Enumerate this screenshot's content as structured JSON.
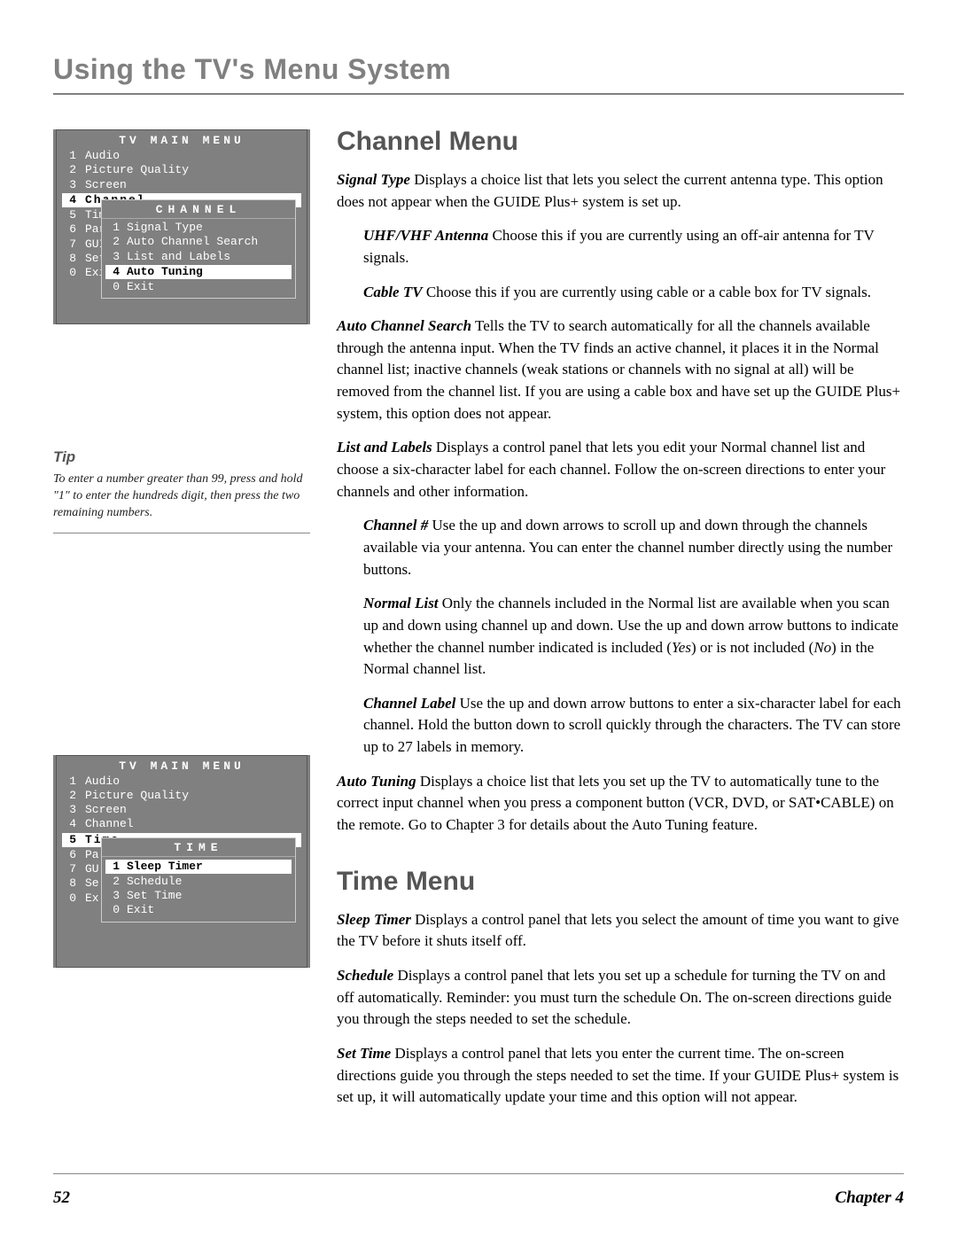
{
  "page_title": "Using the TV's Menu System",
  "footer": {
    "page_num": "52",
    "chapter": "Chapter 4"
  },
  "tip": {
    "heading": "Tip",
    "text": "To enter a number greater than 99, press and hold \"1\" to enter the hundreds digit, then press the two remaining numbers."
  },
  "figure1": {
    "main_title": "TV MAIN MENU",
    "items": [
      {
        "n": "1",
        "label": "Audio"
      },
      {
        "n": "2",
        "label": "Picture Quality"
      },
      {
        "n": "3",
        "label": "Screen"
      },
      {
        "n": "4",
        "label": "Channel",
        "selected": true
      },
      {
        "n": "5",
        "label": "Time"
      },
      {
        "n": "6",
        "label": "Pare"
      },
      {
        "n": "7",
        "label": "GUID"
      },
      {
        "n": "8",
        "label": "Setu"
      },
      {
        "n": "0",
        "label": "Exit"
      }
    ],
    "sub_title": "CHANNEL",
    "sub_items": [
      {
        "n": "1",
        "label": "Signal Type"
      },
      {
        "n": "2",
        "label": "Auto Channel Search"
      },
      {
        "n": "3",
        "label": "List and Labels"
      },
      {
        "n": "4",
        "label": "Auto Tuning",
        "selected": true
      },
      {
        "n": "0",
        "label": "Exit"
      }
    ]
  },
  "figure2": {
    "main_title": "TV MAIN MENU",
    "items": [
      {
        "n": "1",
        "label": "Audio"
      },
      {
        "n": "2",
        "label": "Picture Quality"
      },
      {
        "n": "3",
        "label": "Screen"
      },
      {
        "n": "4",
        "label": "Channel"
      },
      {
        "n": "5",
        "label": "Time",
        "selected": true
      },
      {
        "n": "6",
        "label": "Pa"
      },
      {
        "n": "7",
        "label": "GU"
      },
      {
        "n": "8",
        "label": "Se"
      },
      {
        "n": "0",
        "label": "Ex"
      }
    ],
    "sub_title": "TIME",
    "sub_items": [
      {
        "n": "1",
        "label": "Sleep Timer",
        "selected": true
      },
      {
        "n": "2",
        "label": "Schedule"
      },
      {
        "n": "3",
        "label": "Set Time"
      },
      {
        "n": "0",
        "label": "Exit"
      }
    ]
  },
  "channel_menu": {
    "heading": "Channel Menu",
    "signal_type_term": "Signal Type",
    "signal_type_text": "   Displays a choice list that lets you select the current antenna type. This option does not appear when the GUIDE Plus+ system is set up.",
    "uhf_term": "UHF/VHF Antenna",
    "uhf_text": "   Choose this if you are currently using an off-air antenna for TV signals.",
    "cable_term": "Cable TV",
    "cable_text": "   Choose this if you are currently using cable or a cable box for TV signals.",
    "auto_search_term": "Auto Channel Search",
    "auto_search_text": "   Tells the TV to search automatically for all the channels available through the antenna input. When the TV finds an active channel, it places it in the Normal channel list; inactive channels (weak stations or channels with no signal at all) will be removed from the channel list. If you are using a cable box and have set up the GUIDE Plus+ system, this option does not appear.",
    "list_labels_term": "List and Labels",
    "list_labels_text": "   Displays a control panel that lets you edit your Normal channel list and choose a six-character label for each channel. Follow the on-screen directions to enter your channels and other information.",
    "chnum_term": "Channel #",
    "chnum_text": "   Use the up and down arrows to scroll up and down through the channels available via your antenna. You can enter the channel number directly using the number buttons.",
    "normal_list_term": "Normal List",
    "normal_list_text_a": "   Only the channels included in the Normal list are available when you scan up and down using channel up and down. Use the up and down arrow buttons to indicate whether the channel number indicated is included (",
    "yes_word": "Yes",
    "normal_list_text_b": ") or is not included (",
    "no_word": "No",
    "normal_list_text_c": ") in the Normal channel list.",
    "chlabel_term": "Channel Label",
    "chlabel_text": "   Use the up and down arrow buttons to enter a six-character label for each channel. Hold the button down to scroll quickly through the characters. The TV can store up to 27 labels in memory.",
    "auto_tuning_term": "Auto Tuning",
    "auto_tuning_text": "   Displays a choice list that lets you set up the TV to automatically tune to the correct input channel when you press a component button (VCR, DVD, or SAT•CABLE) on the remote. Go to Chapter 3 for details about the Auto Tuning feature."
  },
  "time_menu": {
    "heading": "Time Menu",
    "sleep_term": "Sleep Timer",
    "sleep_text": "   Displays a control panel that lets you select the amount of time you want to give the TV before it shuts itself off.",
    "schedule_term": "Schedule",
    "schedule_text": "   Displays a control panel that lets you set up a schedule for turning the TV on and off automatically. Reminder: you must turn the schedule On. The on-screen directions guide you through the steps needed to set the schedule.",
    "settime_term": "Set Time",
    "settime_text": "   Displays a control panel that lets you enter the current time. The on-screen directions guide you through the steps needed to set the time. If your GUIDE Plus+ system is set up, it will automatically update your time and this option will not appear."
  }
}
